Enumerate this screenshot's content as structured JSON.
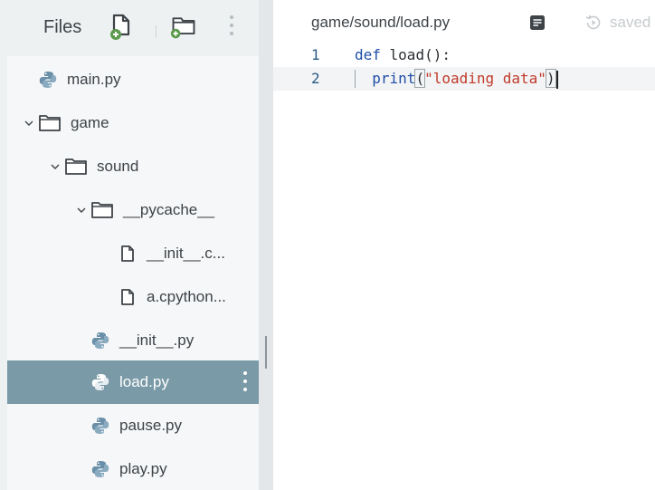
{
  "sidebar": {
    "title": "Files",
    "tree": [
      {
        "label": "main.py",
        "type": "python",
        "depth": 0
      },
      {
        "label": "game",
        "type": "folder",
        "depth": 0,
        "expanded": true
      },
      {
        "label": "sound",
        "type": "folder",
        "depth": 1,
        "expanded": true
      },
      {
        "label": "__pycache__",
        "type": "folder",
        "depth": 2,
        "expanded": true
      },
      {
        "label": "__init__.c...",
        "type": "file",
        "depth": 3
      },
      {
        "label": "a.cpython...",
        "type": "file",
        "depth": 3
      },
      {
        "label": "__init__.py",
        "type": "python",
        "depth": 2
      },
      {
        "label": "load.py",
        "type": "python",
        "depth": 2,
        "selected": true
      },
      {
        "label": "pause.py",
        "type": "python",
        "depth": 2
      },
      {
        "label": "play.py",
        "type": "python",
        "depth": 2
      }
    ]
  },
  "editor": {
    "tab_path": "game/sound/load.py",
    "saved_label": "saved",
    "lines": [
      {
        "number": "1",
        "tokens": [
          {
            "t": "def",
            "c": "kw"
          },
          {
            "t": " load():",
            "c": "plain"
          }
        ]
      },
      {
        "number": "2",
        "tokens": [
          {
            "t": "  ",
            "c": "plain"
          },
          {
            "t": "print",
            "c": "fn"
          },
          {
            "t": "(",
            "c": "plain"
          },
          {
            "t": "\"loading data\"",
            "c": "str"
          },
          {
            "t": ")",
            "c": "plain"
          }
        ]
      }
    ]
  },
  "colors": {
    "selected_row": "#7a9aa7",
    "python_icon": "#6a8fa8",
    "keyword": "#1f4ea8",
    "string": "#c0392b"
  }
}
